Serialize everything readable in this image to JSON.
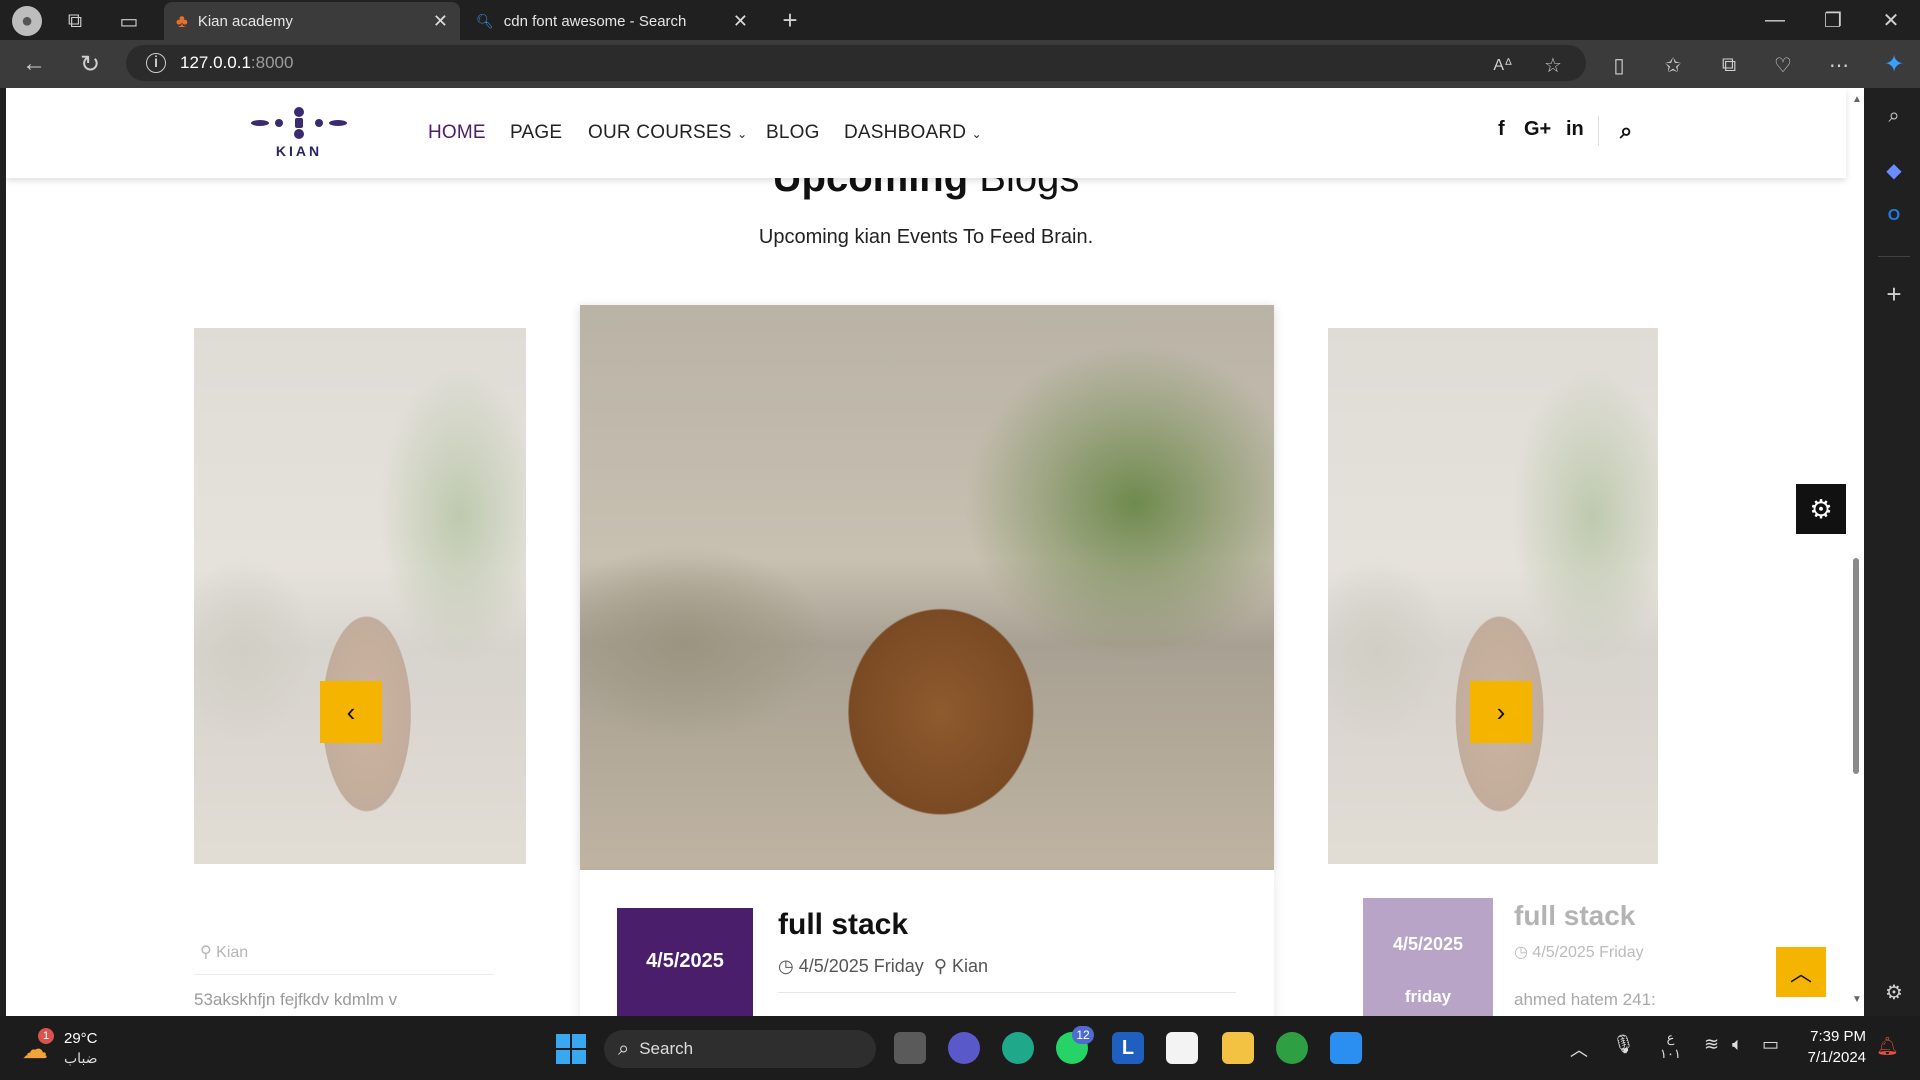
{
  "browser": {
    "tabs": [
      {
        "title": "Kian academy"
      },
      {
        "title": "cdn font awesome - Search"
      }
    ],
    "url_host": "127.0.0.1",
    "url_port": ":8000"
  },
  "nav": {
    "logo_text": "KIAN",
    "items": [
      "HOME",
      "PAGE",
      "OUR COURSES",
      "BLOG",
      "DASHBOARD"
    ],
    "social": [
      "f",
      "G+",
      "in"
    ]
  },
  "section": {
    "title_bold": "Upcoming",
    "title_light": "Blogs",
    "subtitle": "Upcoming kian Events To Feed Brain."
  },
  "cards": {
    "left": {
      "location": "Kian",
      "excerpt": "53akskhfjn fejfkdv kdmlm v"
    },
    "center": {
      "date": "4/5/2025",
      "title": "full stack",
      "meta_date": "4/5/2025 Friday",
      "location": "Kian"
    },
    "right": {
      "date": "4/5/2025",
      "day": "friday",
      "title": "full stack",
      "meta_date": "4/5/2025 Friday",
      "excerpt": "ahmed hatem 241:"
    }
  },
  "taskbar": {
    "weather_temp": "29°C",
    "weather_desc": "ضباب",
    "weather_badge": "1",
    "search_label": "Search",
    "whatsapp_badge": "12",
    "time": "7:39 PM",
    "date": "7/1/2024",
    "lang_top": "ع",
    "lang_bottom": "١٠١"
  },
  "colors": {
    "accent": "#4a1e6b",
    "arrow": "#f5b400"
  }
}
